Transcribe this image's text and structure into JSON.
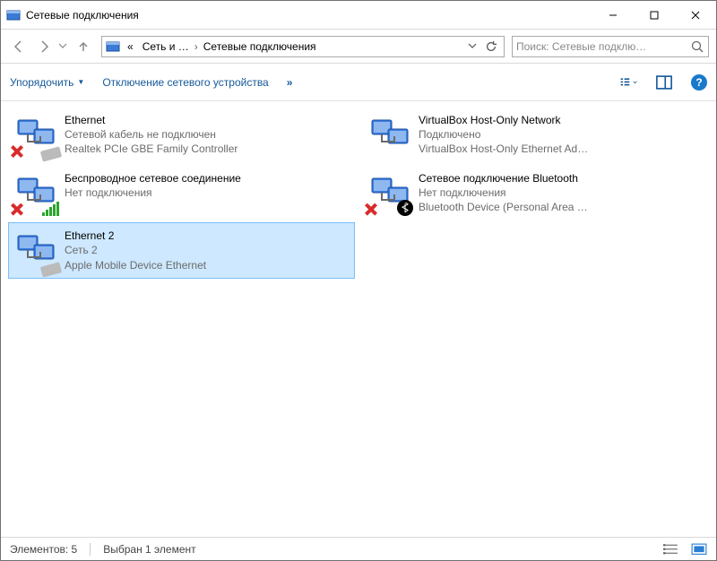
{
  "window": {
    "title": "Сетевые подключения"
  },
  "nav": {
    "crumb_prefix": "«",
    "crumb1": "Сеть и …",
    "crumb2": "Сетевые подключения"
  },
  "search": {
    "placeholder": "Поиск: Сетевые подклю…"
  },
  "toolbar": {
    "organize": "Упорядочить",
    "disable": "Отключение сетевого устройства",
    "more": "»"
  },
  "connections": [
    {
      "name": "Ethernet",
      "status": "Сетевой кабель не подключен",
      "device": "Realtek PCIe GBE Family Controller",
      "overlay": "x-plug",
      "selected": false
    },
    {
      "name": "VirtualBox Host-Only Network",
      "status": "Подключено",
      "device": "VirtualBox Host-Only Ethernet Ad…",
      "overlay": "",
      "selected": false
    },
    {
      "name": "Беспроводное сетевое соединение",
      "status": "Нет подключения",
      "device": "",
      "overlay": "x-bars",
      "selected": false
    },
    {
      "name": "Сетевое подключение Bluetooth",
      "status": "Нет подключения",
      "device": "Bluetooth Device (Personal Area …",
      "overlay": "x-bt",
      "selected": false
    },
    {
      "name": "Ethernet 2",
      "status": "Сеть  2",
      "device": "Apple Mobile Device Ethernet",
      "overlay": "plug",
      "selected": true
    }
  ],
  "statusbar": {
    "count_label": "Элементов: 5",
    "selection_label": "Выбран 1 элемент"
  }
}
